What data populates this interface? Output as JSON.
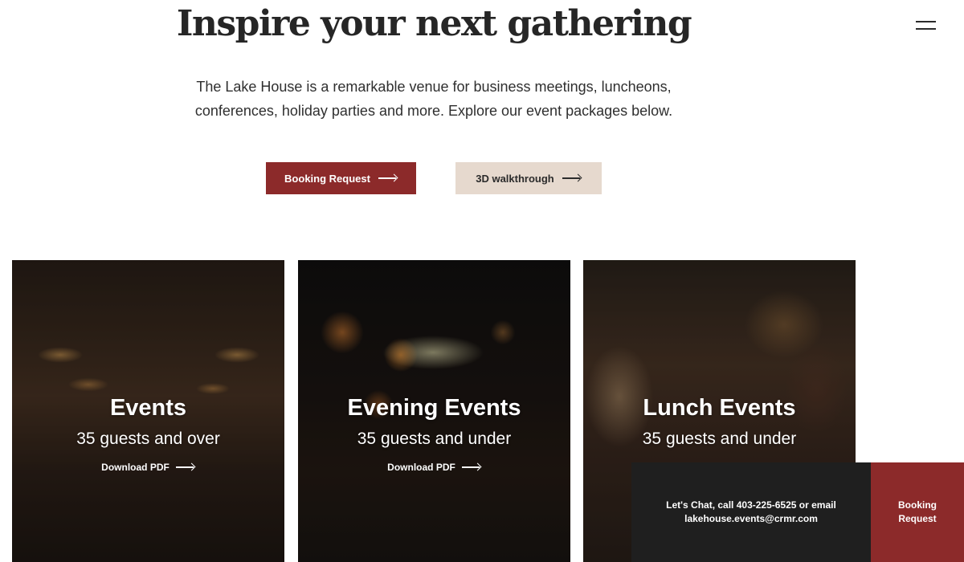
{
  "header": {
    "title": "Inspire your next gathering",
    "menu_icon": "hamburger-menu-icon"
  },
  "intro": {
    "text": "The Lake House is a remarkable venue for business meetings, luncheons, conferences, holiday parties and more. Explore our event packages below."
  },
  "actions": {
    "booking_label": "Booking Request",
    "walkthrough_label": "3D walkthrough",
    "arrow_icon": "arrow-right-icon"
  },
  "cards": [
    {
      "title": "Events",
      "subtitle": "35 guests and over",
      "link": "Download PDF"
    },
    {
      "title": "Evening Events",
      "subtitle": "35 guests and under",
      "link": "Download PDF"
    },
    {
      "title": "Lunch Events",
      "subtitle": "35 guests and under",
      "link": ""
    }
  ],
  "footer_bar": {
    "chat_text": "Let's Chat, call 403-225-6525 or email lakehouse.events@crmr.com",
    "booking_label": "Booking Request"
  },
  "colors": {
    "brand_red": "#8c2a2a",
    "beige": "#e6d9ce",
    "dark_bar": "#1f1f1f",
    "text": "#2b2b2b"
  }
}
